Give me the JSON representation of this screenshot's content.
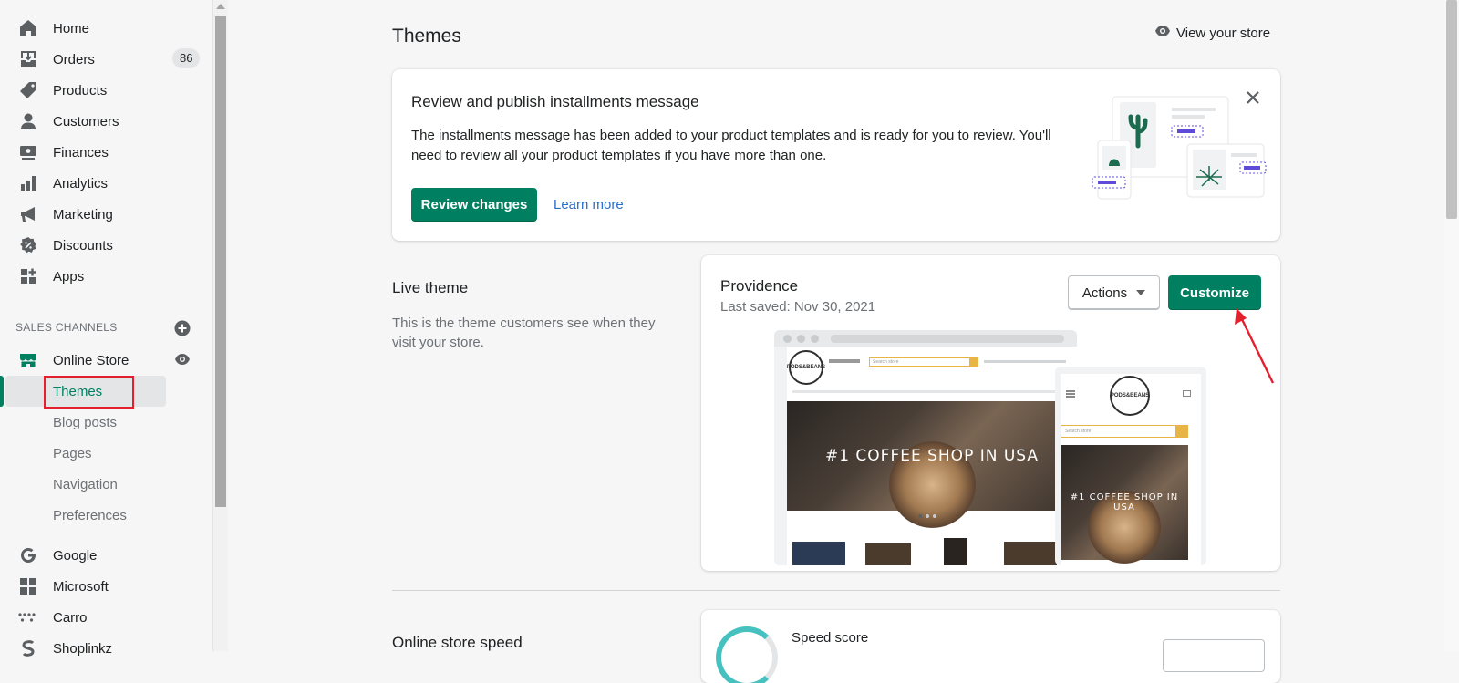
{
  "sidebar": {
    "items": [
      {
        "label": "Home",
        "icon": "home-icon"
      },
      {
        "label": "Orders",
        "icon": "orders-icon",
        "badge": "86"
      },
      {
        "label": "Products",
        "icon": "tag-icon"
      },
      {
        "label": "Customers",
        "icon": "person-icon"
      },
      {
        "label": "Finances",
        "icon": "finances-icon"
      },
      {
        "label": "Analytics",
        "icon": "bar-chart-icon"
      },
      {
        "label": "Marketing",
        "icon": "megaphone-icon"
      },
      {
        "label": "Discounts",
        "icon": "discount-icon"
      },
      {
        "label": "Apps",
        "icon": "apps-icon"
      }
    ],
    "sales_channels_label": "SALES CHANNELS",
    "online_store": {
      "label": "Online Store"
    },
    "sub_items": [
      "Themes",
      "Blog posts",
      "Pages",
      "Navigation",
      "Preferences"
    ],
    "channels": [
      {
        "label": "Google",
        "icon": "google-icon"
      },
      {
        "label": "Microsoft",
        "icon": "microsoft-icon"
      },
      {
        "label": "Carro",
        "icon": "carro-icon"
      },
      {
        "label": "Shoplinkz",
        "icon": "shoplinkz-icon"
      }
    ]
  },
  "header": {
    "title": "Themes",
    "view_store": "View your store"
  },
  "banner": {
    "title": "Review and publish installments message",
    "description": "The installments message has been added to your product templates and is ready for you to review. You'll need to review all your product templates if you have more than one.",
    "primary_button": "Review changes",
    "secondary_link": "Learn more"
  },
  "live_theme": {
    "heading": "Live theme",
    "description": "This is the theme customers see when they visit your store.",
    "theme_name": "Providence",
    "last_saved": "Last saved: Nov 30, 2021",
    "actions_button": "Actions",
    "customize_button": "Customize",
    "preview_hero_text": "#1 COFFEE SHOP IN USA",
    "preview_mobile_hero_text": "#1 COFFEE SHOP IN USA",
    "preview_search_placeholder": "Search store",
    "preview_logo_text": "PODS&BEANS"
  },
  "speed": {
    "heading": "Online store speed",
    "score_label": "Speed score"
  },
  "colors": {
    "accent": "#008060",
    "annotation_red": "#e5202e",
    "link": "#2c6ecb"
  }
}
